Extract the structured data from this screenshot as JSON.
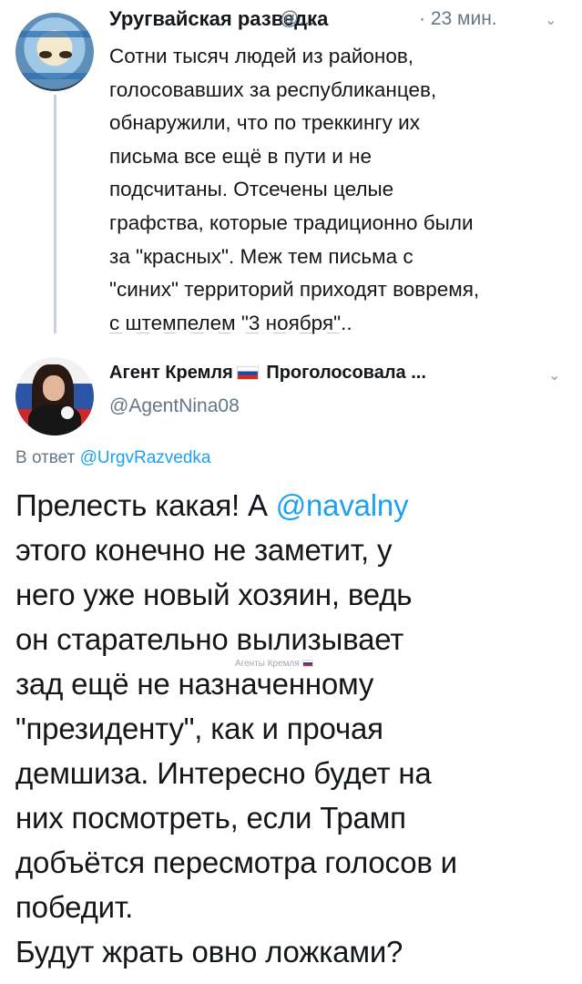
{
  "tweet1": {
    "author_name": "Уругвайская разведка",
    "handle": "@...",
    "separator": "·",
    "time": "23 мин.",
    "text_lines": [
      "Сотни тысяч людей из районов,",
      "голосовавших за республиканцев,",
      "обнаружили, что по треккингу их",
      "письма все ещё в пути и не",
      "подсчитаны. Отсечены целые",
      "графства, которые традиционно были",
      "за \"красных\". Меж тем письма с",
      "\"синих\" территорий приходят вовремя,",
      "с штемпелем \"3 ноября\".."
    ]
  },
  "tweet2": {
    "author_name": "Агент Кремля",
    "status": "Проголосовала ...",
    "handle": "@AgentNina08",
    "reply_prefix": "В ответ",
    "reply_to": "@UrgvRazvedka",
    "text_before_mention": "Прелесть какая! А ",
    "mention": "@navalny",
    "text_after_mention": [
      "этого конечно не заметит, у",
      "него уже новый хозяин, ведь",
      "он старательно вылизывает",
      "зад ещё не назначенному",
      "\"президенту\", как и прочая",
      "демшиза. Интересно будет на",
      "них посмотреть, если Трамп",
      "добъётся пересмотра голосов и",
      "победит.",
      "Будут жрать овно ложками?"
    ]
  },
  "watermark": "Агенты Кремля",
  "icons": {
    "chevron": "chevron-down-icon",
    "flag": "russia-flag-icon"
  },
  "colors": {
    "link": "#1da1f2",
    "secondary_text": "#657786",
    "thread_line": "#c9d1d8"
  }
}
